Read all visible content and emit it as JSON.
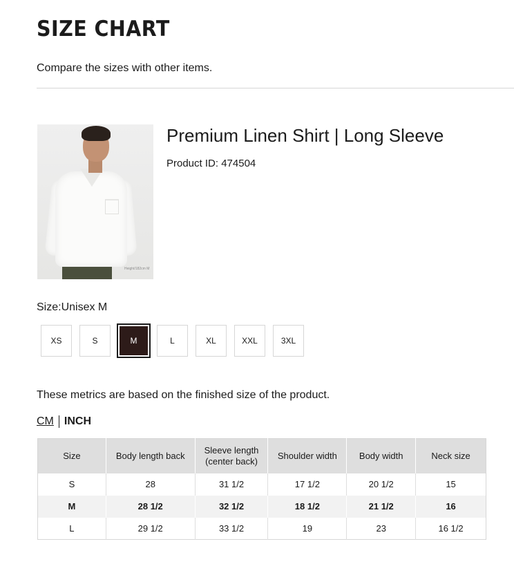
{
  "header": {
    "title": "SIZE CHART",
    "subtitle": "Compare the sizes with other items."
  },
  "product": {
    "name": "Premium Linen Shirt | Long Sleeve",
    "id_text": "Product ID: 474504",
    "image_note": "Height/182cm M"
  },
  "size_selector": {
    "label": "Size:Unisex M",
    "options": [
      "XS",
      "S",
      "M",
      "L",
      "XL",
      "XXL",
      "3XL"
    ],
    "selected": "M"
  },
  "metrics_note": "These metrics are based on the finished size of the product.",
  "units": {
    "cm": "CM",
    "inch": "INCH",
    "active": "INCH"
  },
  "table": {
    "headers": [
      "Size",
      "Body length back",
      "Sleeve length (center back)",
      "Shoulder width",
      "Body width",
      "Neck size"
    ],
    "rows": [
      [
        "S",
        "28",
        "31 1/2",
        "17 1/2",
        "20 1/2",
        "15"
      ],
      [
        "M",
        "28 1/2",
        "32 1/2",
        "18 1/2",
        "21 1/2",
        "16"
      ],
      [
        "L",
        "29 1/2",
        "33 1/2",
        "19",
        "23",
        "16 1/2"
      ]
    ],
    "highlighted_row": "M"
  },
  "colors": {
    "selected_size_bg": "#2d1b19",
    "header_bg": "#dedede",
    "highlight_row_bg": "#f2f2f2"
  }
}
